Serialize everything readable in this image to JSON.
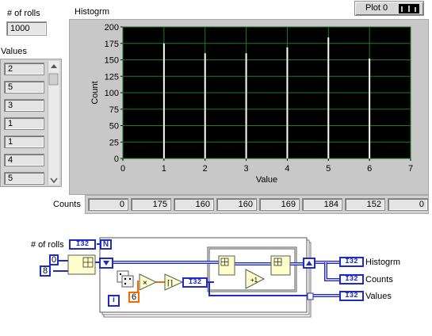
{
  "controls": {
    "rolls_label": "# of rolls",
    "rolls_value": "1000",
    "values_label": "Values",
    "values": [
      "2",
      "5",
      "3",
      "1",
      "1",
      "4",
      "5"
    ]
  },
  "graph": {
    "label": "Histogrm",
    "legend_label": "Plot 0",
    "plot_bg": "#000000",
    "grid_color": "#1e7a1e",
    "bar_color": "#ffffff"
  },
  "chart_data": {
    "type": "bar",
    "x": [
      0,
      1,
      2,
      3,
      4,
      5,
      6,
      7
    ],
    "values": [
      0,
      175,
      160,
      160,
      169,
      184,
      152,
      0
    ],
    "xlabel": "Value",
    "ylabel": "Count",
    "xlim": [
      0,
      7
    ],
    "ylim": [
      0,
      200
    ],
    "x_ticks": [
      "0",
      "1",
      "2",
      "3",
      "4",
      "5",
      "6",
      "7"
    ],
    "y_ticks": [
      "0",
      "25",
      "50",
      "75",
      "100",
      "125",
      "150",
      "175",
      "200"
    ],
    "grid": true
  },
  "counts": {
    "label": "Counts",
    "values": [
      "0",
      "175",
      "160",
      "160",
      "169",
      "184",
      "152",
      "0"
    ]
  },
  "diagram": {
    "rolls_label": "# of rolls",
    "i32": "I32",
    "n_label": "N",
    "i_label": "i",
    "const_0": "0",
    "const_8": "8",
    "const_6": "6",
    "out_histogram": "Histogrm",
    "out_counts": "Counts",
    "out_values": "Values",
    "wire_color": "#1f2bc6",
    "dbl_wire_color": "#f26a00"
  }
}
